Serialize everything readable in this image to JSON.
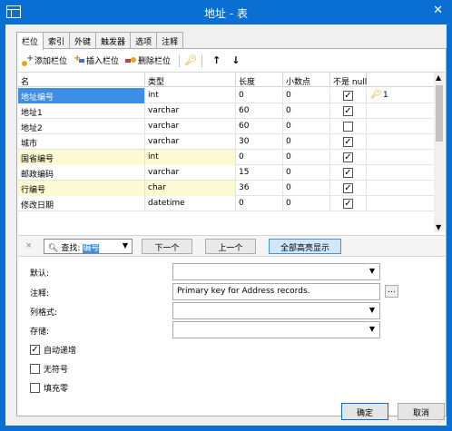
{
  "window": {
    "title": "地址 - 表",
    "close_glyph": "✕"
  },
  "tabs": [
    {
      "label": "栏位",
      "active": true
    },
    {
      "label": "索引"
    },
    {
      "label": "外键"
    },
    {
      "label": "触发器"
    },
    {
      "label": "选项"
    },
    {
      "label": "注释"
    }
  ],
  "toolbar": {
    "add_field": "添加栏位",
    "insert_field": "插入栏位",
    "delete_field": "删除栏位",
    "primary_key_icon": "key-icon",
    "move_up": "↑",
    "move_down": "↓"
  },
  "grid": {
    "columns": [
      "名",
      "类型",
      "长度",
      "小数点",
      "不是 null",
      ""
    ],
    "rows": [
      {
        "name": "地址编号",
        "type": "int",
        "length": "0",
        "decimals": "0",
        "not_null": true,
        "key": "1",
        "selected": true,
        "readonly": false
      },
      {
        "name": "地址1",
        "type": "varchar",
        "length": "60",
        "decimals": "0",
        "not_null": true,
        "key": "",
        "selected": false,
        "readonly": false
      },
      {
        "name": "地址2",
        "type": "varchar",
        "length": "60",
        "decimals": "0",
        "not_null": false,
        "key": "",
        "selected": false,
        "readonly": false
      },
      {
        "name": "城市",
        "type": "varchar",
        "length": "30",
        "decimals": "0",
        "not_null": true,
        "key": "",
        "selected": false,
        "readonly": false
      },
      {
        "name": "国省编号",
        "type": "int",
        "length": "0",
        "decimals": "0",
        "not_null": true,
        "key": "",
        "selected": false,
        "readonly": true
      },
      {
        "name": "邮政编码",
        "type": "varchar",
        "length": "15",
        "decimals": "0",
        "not_null": true,
        "key": "",
        "selected": false,
        "readonly": false
      },
      {
        "name": "行编号",
        "type": "char",
        "length": "36",
        "decimals": "0",
        "not_null": true,
        "key": "",
        "selected": false,
        "readonly": true
      },
      {
        "name": "修改日期",
        "type": "datetime",
        "length": "0",
        "decimals": "0",
        "not_null": true,
        "key": "",
        "selected": false,
        "readonly": false
      }
    ]
  },
  "find": {
    "close": "×",
    "label": "查找:",
    "value": "编号",
    "next": "下一个",
    "prev": "上一个",
    "highlight_all": "全部高亮显示"
  },
  "properties": {
    "default_label": "默认:",
    "default_value": "",
    "comment_label": "注释:",
    "comment_value": "Primary key for Address records.",
    "column_format_label": "列格式:",
    "column_format_value": "",
    "storage_label": "存储:",
    "storage_value": "",
    "auto_increment_label": "自动递增",
    "auto_increment": true,
    "unsigned_label": "无符号",
    "unsigned": false,
    "zerofill_label": "填充零",
    "zerofill": false
  },
  "footer": {
    "ok": "确定",
    "cancel": "取消"
  }
}
